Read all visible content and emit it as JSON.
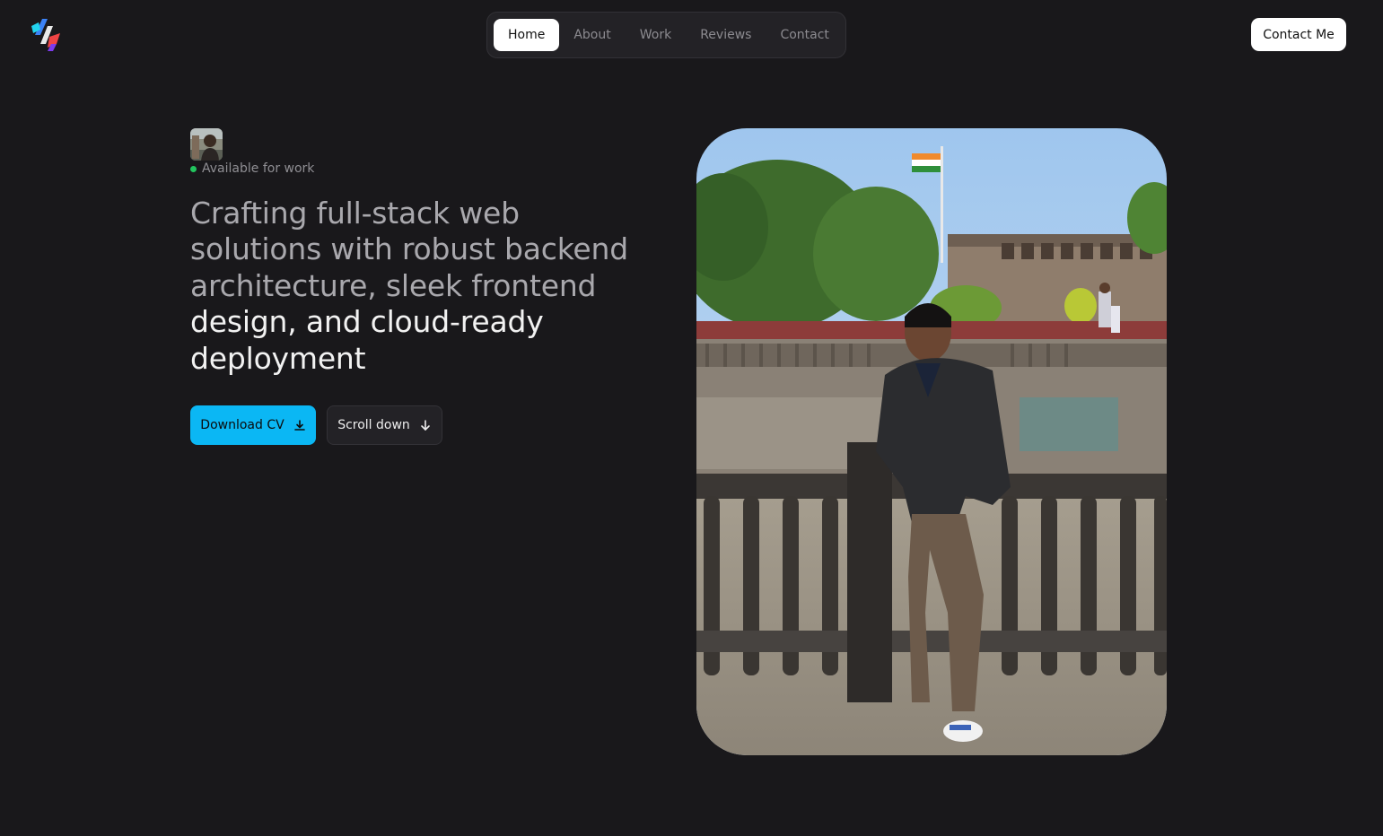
{
  "header": {
    "logo_icon": "brand-logo-icon",
    "nav": [
      {
        "label": "Home",
        "active": true
      },
      {
        "label": "About",
        "active": false
      },
      {
        "label": "Work",
        "active": false
      },
      {
        "label": "Reviews",
        "active": false
      },
      {
        "label": "Contact",
        "active": false
      }
    ],
    "contact_button": "Contact Me"
  },
  "hero": {
    "avatar_icon": "avatar-photo",
    "status": "Available for work",
    "status_color": "#22c55e",
    "headline_dim": "Crafting full-stack web solutions with robust backend architecture, sleek frontend ",
    "headline_bright": "design, and cloud-ready deployment",
    "download_button": "Download CV",
    "download_icon": "download-icon",
    "scroll_button": "Scroll down",
    "scroll_icon": "arrow-down-icon",
    "photo_icon": "profile-photo"
  },
  "colors": {
    "background": "#19181b",
    "accent": "#0bb7f4",
    "nav_background": "#232226"
  }
}
